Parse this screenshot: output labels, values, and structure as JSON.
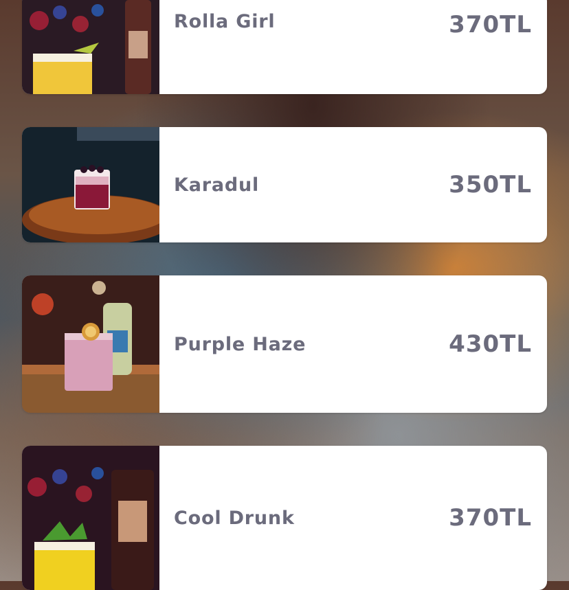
{
  "menu": {
    "items": [
      {
        "name": "Rolla Girl",
        "price": "370TL",
        "photo": "yellow cocktail with apple garnish, red bokeh bar background"
      },
      {
        "name": "Karadul",
        "price": "350TL",
        "photo": "dark berry cocktail in short glass on wooden table"
      },
      {
        "name": "Purple Haze",
        "price": "430TL",
        "photo": "pink cocktail with dried citrus wheel beside a bottle"
      },
      {
        "name": "Cool Drunk",
        "price": "370TL",
        "photo": "yellow cocktail with mint garnish, red bokeh bar background"
      }
    ]
  },
  "colors": {
    "card_bg": "#ffffff",
    "text": "#6b6b7c"
  }
}
